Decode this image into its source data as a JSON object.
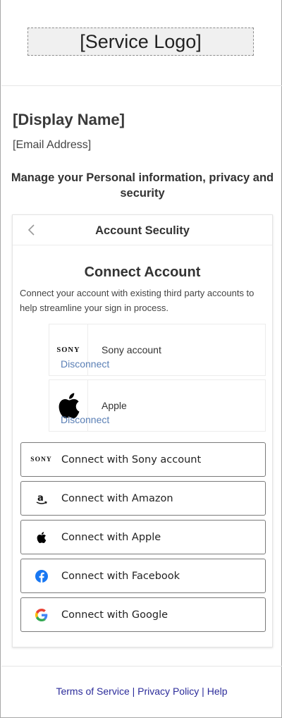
{
  "header": {
    "logo_text": "[Service Logo]"
  },
  "profile": {
    "display_name": "[Display Name]",
    "email": "[Email Address]"
  },
  "manage_heading": "Manage your Personal information, privacy and security",
  "card": {
    "title": "Account Seculity",
    "connect_title": "Connect Account",
    "description": "Connect your account with existing third party accounts to help streamline your sign in process.",
    "linked_accounts": [
      {
        "logo": "SONY",
        "icon": "sony-logo",
        "name": "Sony account",
        "action": "Disconnect"
      },
      {
        "logo": "",
        "icon": "apple-icon",
        "name": "Apple",
        "action": "Disconnect"
      }
    ],
    "connect_buttons": [
      {
        "icon": "sony-logo",
        "icon_text": "SONY",
        "label": "Connect with Sony account"
      },
      {
        "icon": "amazon-icon",
        "label": "Connect with Amazon"
      },
      {
        "icon": "apple-icon",
        "label": "Connect with Apple"
      },
      {
        "icon": "facebook-icon",
        "label": "Connect with Facebook"
      },
      {
        "icon": "google-icon",
        "label": "Connect with Google"
      }
    ]
  },
  "footer": {
    "links": [
      "Terms of Service",
      "Privacy Policy",
      "Help"
    ],
    "separator": " | "
  },
  "colors": {
    "link": "#5a7fb5",
    "footer_link": "#2b2b9a",
    "facebook": "#1877f2"
  }
}
